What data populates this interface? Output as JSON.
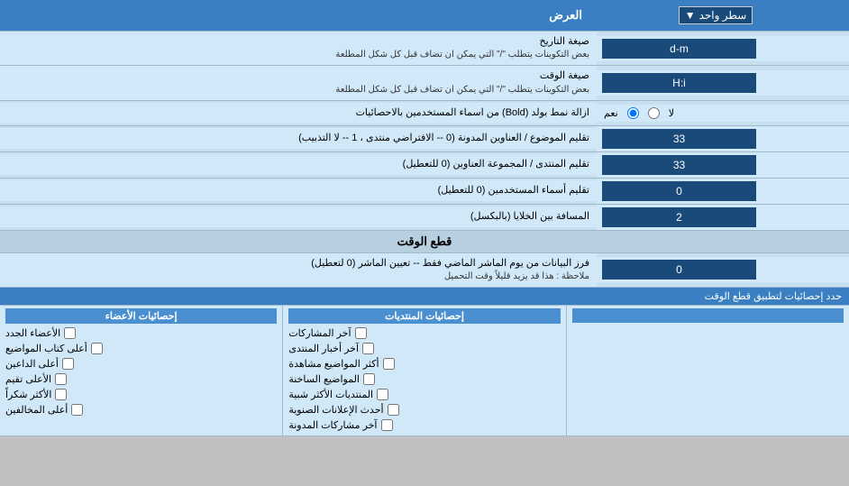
{
  "header": {
    "label": "العرض",
    "dropdown_label": "سطر واحد"
  },
  "rows": [
    {
      "id": "date_format",
      "label": "صيغة التاريخ",
      "sub_label": "بعض التكوينات يتطلب \"/\" التي يمكن ان تضاف قبل كل شكل المطلعة",
      "input_value": "d-m",
      "type": "input"
    },
    {
      "id": "time_format",
      "label": "صيغة الوقت",
      "sub_label": "بعض التكوينات يتطلب \"/\" التي يمكن ان تضاف قبل كل شكل المطلعة",
      "input_value": "H:i",
      "type": "input"
    },
    {
      "id": "bold_remove",
      "label": "ازالة نمط بولد (Bold) من اسماء المستخدمين بالاحصائيات",
      "radio_options": [
        "نعم",
        "لا"
      ],
      "radio_selected": "نعم",
      "type": "radio"
    },
    {
      "id": "topic_sort",
      "label": "تقليم الموضوع / العناوين المدونة (0 -- الافتراضي منتدى ، 1 -- لا التذبيب)",
      "input_value": "33",
      "type": "input"
    },
    {
      "id": "forum_trim",
      "label": "تقليم المنتدى / المجموعة العناوين (0 للتعطيل)",
      "input_value": "33",
      "type": "input"
    },
    {
      "id": "user_trim",
      "label": "تقليم أسماء المستخدمين (0 للتعطيل)",
      "input_value": "0",
      "type": "input"
    },
    {
      "id": "cell_space",
      "label": "المسافة بين الخلايا (بالبكسل)",
      "input_value": "2",
      "type": "input"
    }
  ],
  "cut_section": {
    "header": "قطع الوقت",
    "row": {
      "label": "فرز البيانات من يوم الماشر الماضي فقط -- تعيين الماشر (0 لتعطيل)",
      "sub_label": "ملاحظة : هذا قد يزيد قليلاً وقت التحميل",
      "input_value": "0"
    },
    "checkboxes_header": "حدد إحصائيات لتطبيق قطع الوقت"
  },
  "checkbox_columns": [
    {
      "id": "col1",
      "header": "إحصائيات الأعضاء",
      "items": [
        "الأعضاء الجدد",
        "أعلى كتاب المواضيع",
        "أعلى الداعين",
        "الأعلى تقيم",
        "الأكثر شكراً",
        "أعلى المخالفين"
      ]
    },
    {
      "id": "col2",
      "header": "إحصائيات المنتديات",
      "items": [
        "آخر المشاركات",
        "آخر أخبار المنتدى",
        "أكثر المواضيع مشاهدة",
        "المواضيع الساخنة",
        "المنتديات الأكثر شبية",
        "أحدث الإعلانات الصنوية",
        "آخر مشاركات المدونة"
      ]
    },
    {
      "id": "col3",
      "header": "",
      "items": []
    }
  ]
}
